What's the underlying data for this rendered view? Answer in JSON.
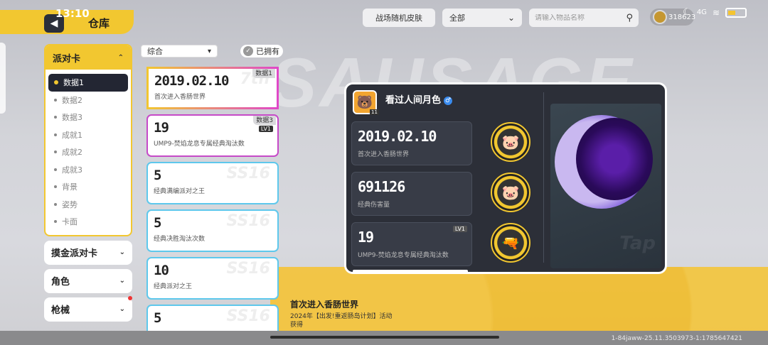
{
  "status_bar": {
    "time": "13:10",
    "signal": "4G"
  },
  "header": {
    "back_icon": "◀",
    "title": "仓库",
    "skin_button": "战场随机皮肤",
    "filter_value": "全部",
    "search_placeholder": "请输入物品名称",
    "currency_value": "318623"
  },
  "background": {
    "brand_text": "SAUSAGE"
  },
  "sidebar": {
    "main_category": {
      "label": "派对卡",
      "items": [
        {
          "label": "数据1",
          "active": true
        },
        {
          "label": "数据2"
        },
        {
          "label": "数据3"
        },
        {
          "label": "成就1"
        },
        {
          "label": "成就2"
        },
        {
          "label": "成就3"
        },
        {
          "label": "背景"
        },
        {
          "label": "姿势"
        },
        {
          "label": "卡面"
        }
      ]
    },
    "collapsed": [
      {
        "label": "摸金派对卡"
      },
      {
        "label": "角色"
      },
      {
        "label": "枪械"
      }
    ]
  },
  "list": {
    "sort_value": "综合",
    "owned_label": "已拥有",
    "cards": [
      {
        "value": "2019.02.10",
        "desc": "首次进入香肠世界",
        "tag": "数据1",
        "watermark": "7th",
        "style": "gold"
      },
      {
        "value": "19",
        "desc": "UMP9-焚焰龙息专属经典淘汰数",
        "tag": "数据3",
        "lv": "LV1",
        "style": "purple"
      },
      {
        "value": "5",
        "desc": "经典满编派对之王",
        "watermark": "SS16",
        "style": "blue"
      },
      {
        "value": "5",
        "desc": "经典决胜淘汰次数",
        "watermark": "SS16",
        "style": "blue"
      },
      {
        "value": "10",
        "desc": "经典派对之王",
        "watermark": "SS16",
        "style": "blue"
      },
      {
        "value": "5",
        "desc": "",
        "watermark": "SS16",
        "style": "blue"
      }
    ]
  },
  "preview": {
    "username": "看过人间月色",
    "gender_icon": "♂",
    "avatar_lv": "11",
    "stats": [
      {
        "value": "2019.02.10",
        "desc": "首次进入香肠世界"
      },
      {
        "value": "691126",
        "desc": "经典伤害量"
      },
      {
        "value": "19",
        "desc": "UMP9-焚焰龙息专属经典淘汰数",
        "lv": "LV1"
      }
    ],
    "art_watermark": "Tap"
  },
  "description": {
    "title": "首次进入香肠世界",
    "text": "2024年【出发!重返肠岛计划】活动获得"
  },
  "footer": {
    "build": "1-84jaww-25.11.3503973-1:1785647421"
  },
  "colors": {
    "accent": "#f2c730",
    "panel": "#2c2f38",
    "card_blue": "#5ec8ec",
    "card_purple": "#c64ac8"
  }
}
